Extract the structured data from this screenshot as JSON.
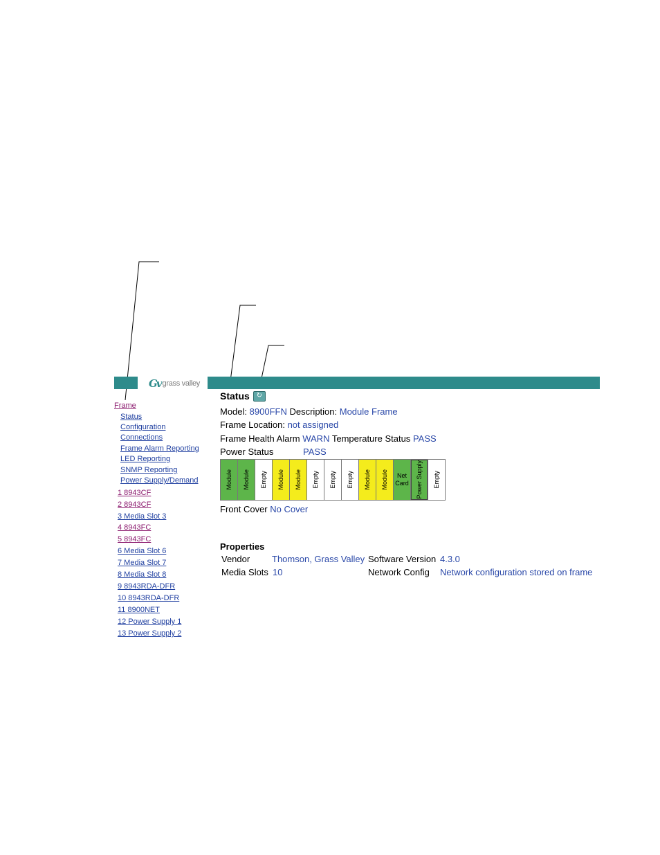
{
  "brand": {
    "logo_mark": "Gv",
    "logo_text": "grass valley",
    "accent": "#2e8b8b"
  },
  "nav": {
    "frame": "Frame",
    "sub_items": [
      "Status",
      "Configuration",
      "Connections",
      "Frame Alarm Reporting",
      "LED Reporting",
      "SNMP Reporting",
      "Power Supply/Demand"
    ],
    "slots": [
      "1 8943CF",
      "2 8943CF",
      "3 Media Slot 3",
      "4 8943FC",
      "5 8943FC",
      "6 Media Slot 6",
      "7 Media Slot 7",
      "8 Media Slot 8",
      "9 8943RDA-DFR",
      "10 8943RDA-DFR",
      "11 8900NET",
      "12 Power Supply 1",
      "13 Power Supply 2"
    ]
  },
  "status": {
    "title": "Status",
    "model_label": "Model:",
    "model_value": "8900FFN",
    "description_label": "Description:",
    "description_value": "Module Frame",
    "location_label": "Frame Location:",
    "location_value": "not assigned",
    "health_label": "Frame Health Alarm",
    "health_value": "WARN",
    "temp_label": "Temperature Status",
    "temp_value": "PASS",
    "power_label": "Power Status",
    "power_value": "PASS",
    "cover_label": "Front Cover",
    "cover_value": "No Cover"
  },
  "frame_slots": [
    {
      "label": "Module",
      "color": "#5db54a"
    },
    {
      "label": "Module",
      "color": "#5db54a"
    },
    {
      "label": "Empty",
      "color": "#ffffff"
    },
    {
      "label": "Module",
      "color": "#f4ec1c"
    },
    {
      "label": "Module",
      "color": "#f4ec1c"
    },
    {
      "label": "Empty",
      "color": "#ffffff"
    },
    {
      "label": "Empty",
      "color": "#ffffff"
    },
    {
      "label": "Empty",
      "color": "#ffffff"
    },
    {
      "label": "Module",
      "color": "#f4ec1c"
    },
    {
      "label": "Module",
      "color": "#f4ec1c"
    },
    {
      "label": "Net Card",
      "color": "#5db54a"
    },
    {
      "label": "Power Supply",
      "color": "#5db54a"
    },
    {
      "label": "Empty",
      "color": "#ffffff"
    }
  ],
  "properties": {
    "title": "Properties",
    "vendor_label": "Vendor",
    "vendor_value": "Thomson, Grass Valley",
    "software_label": "Software Version",
    "software_value": "4.3.0",
    "media_label": "Media Slots",
    "media_value": "10",
    "network_label": "Network Config",
    "network_value": "Network configuration stored on frame"
  }
}
